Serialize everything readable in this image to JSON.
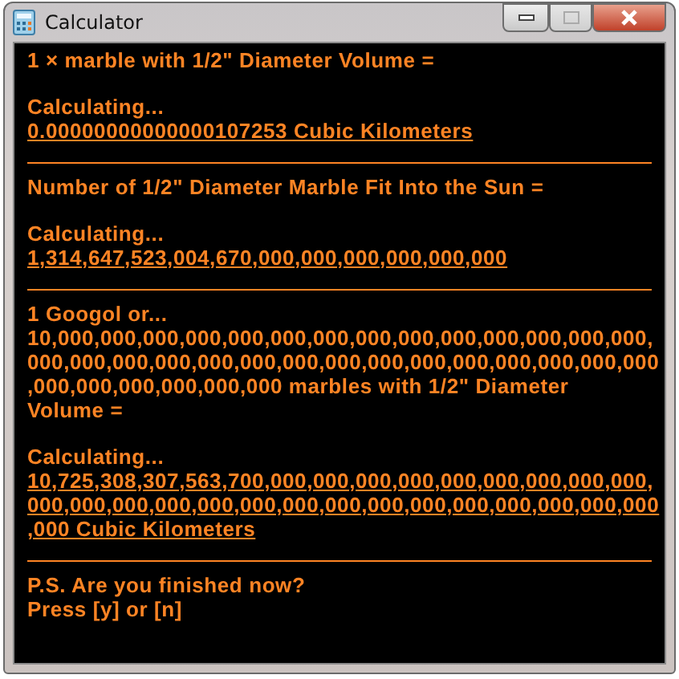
{
  "window": {
    "title": "Calculator"
  },
  "sections": [
    {
      "question_lines": [
        "1 × marble with 1/2\" Diameter Volume ="
      ],
      "status": "Calculating...",
      "result_lines": [
        "0.00000000000000107253 Cubic Kilometers"
      ]
    },
    {
      "question_lines": [
        "Number of 1/2\" Diameter Marble Fit Into the Sun ="
      ],
      "status": "Calculating...",
      "result_lines": [
        "1,314,647,523,004,670,000,000,000,000,000,000"
      ]
    },
    {
      "question_lines": [
        "1 Googol or...",
        "10,000,000,000,000,000,000,000,000,000,000,000,000,000,000,",
        "000,000,000,000,000,000,000,000,000,000,000,000,000,000,000",
        ",000,000,000,000,000,000 marbles with 1/2\" Diameter",
        "Volume ="
      ],
      "status": "Calculating...",
      "result_lines": [
        "10,725,308,307,563,700,000,000,000,000,000,000,000,000,000,",
        "000,000,000,000,000,000,000,000,000,000,000,000,000,000,000",
        ",000 Cubic Kilometers"
      ]
    }
  ],
  "footer_lines": [
    "P.S. Are you finished now?",
    "Press [y] or [n]"
  ]
}
